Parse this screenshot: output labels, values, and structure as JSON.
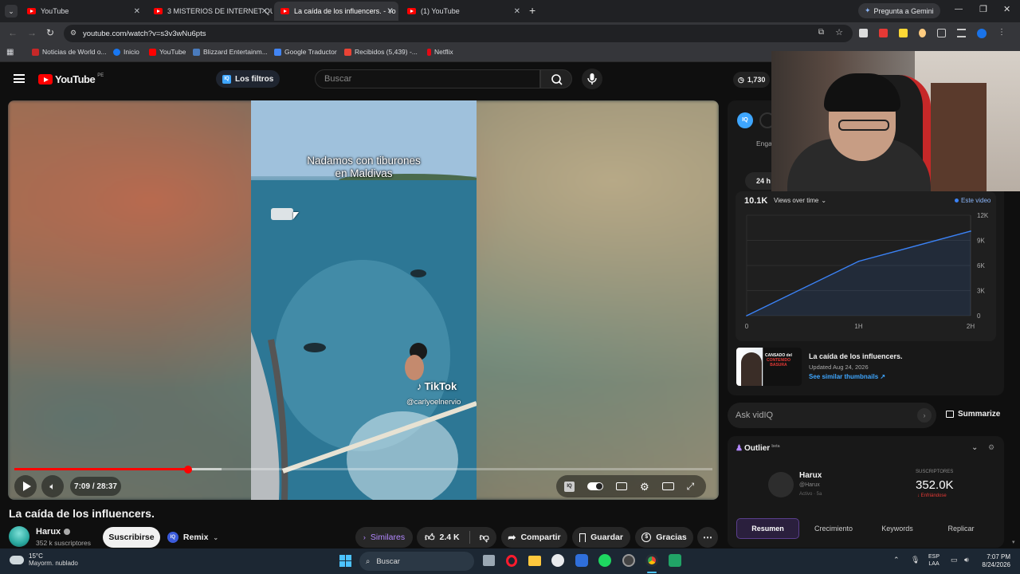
{
  "browser": {
    "tabs": [
      {
        "label": "YouTube",
        "active": false
      },
      {
        "label": "3 MISTERIOS DE INTERNET QUE",
        "active": false
      },
      {
        "label": "La caída de los influencers. - Yo",
        "active": true
      },
      {
        "label": "(1) YouTube",
        "active": false
      }
    ],
    "new_tab": "+",
    "gemini": "Pregunta a Gemini",
    "url": "youtube.com/watch?v=s3v3wNu6pts",
    "bookmarks": [
      "Noticias de World o...",
      "Inicio",
      "YouTube",
      "Blizzard Entertainm...",
      "Google Traductor",
      "Recibidos (5,439) -...",
      "Netflix"
    ]
  },
  "youtube": {
    "logo": "YouTube",
    "region": "PE",
    "filters": "Los filtros",
    "search_placeholder": "Buscar",
    "views_counter": "1,730"
  },
  "video": {
    "overlay_caption_line1": "Nadamos con tiburones",
    "overlay_caption_line2": "en Maldivas",
    "watermark": "TikTok",
    "watermark_user": "@carlyoelnervio",
    "time": "7:09 / 28:37",
    "progress_fraction": 0.249,
    "buffer_fraction": 0.297,
    "title": "La caída de los influencers.",
    "channel": "Harux",
    "subscribers": "352 k suscriptores",
    "subscribe": "Suscribirse",
    "remix": "Remix",
    "similares": "Similares",
    "likes": "2.4 K",
    "share": "Compartir",
    "save": "Guardar",
    "thanks": "Gracias"
  },
  "vidiq": {
    "tab_label": "Enga",
    "range_label": "24 h",
    "views": "10.1K",
    "views_dropdown": "Views over time",
    "legend": "Este video",
    "thumb_title": "La caída de los influencers.",
    "thumb_updated": "Updated Aug 24, 2026",
    "thumb_link": "See similar thumbnails",
    "thumb_text_1": "CANSADO del",
    "thumb_text_2": "CONTENIDO",
    "thumb_text_3": "BASURA",
    "ask_placeholder": "Ask vidIQ",
    "summarize": "Summarize",
    "outlier": "Outlier",
    "outlier_badge": "beta",
    "channel_name": "Harux",
    "channel_handle": "@Harux",
    "channel_status": "Activo · 5a",
    "subs_label": "SUSCRIPTORES",
    "subs_value": "352.0K",
    "subs_trend": "Enfriándose",
    "tabs": [
      "Resumen",
      "Crecimiento",
      "Keywords",
      "Replicar"
    ]
  },
  "chart_data": {
    "type": "line",
    "x": [
      0,
      1,
      2
    ],
    "xtick_labels": [
      "0",
      "1H",
      "2H"
    ],
    "series": [
      {
        "name": "Este video",
        "values": [
          0,
          6500,
          10100
        ]
      }
    ],
    "ylim": [
      0,
      12000
    ],
    "yticks": [
      0,
      3000,
      6000,
      9000,
      12000
    ],
    "ytick_labels": [
      "0",
      "3K",
      "6K",
      "9K",
      "12K"
    ],
    "grid": true,
    "legend_position": "top-right"
  },
  "taskbar": {
    "weather_temp": "15°C",
    "weather_desc": "Mayorm. nublado",
    "search": "Buscar",
    "lang_1": "ESP",
    "lang_2": "LAA",
    "time": "7:07 PM",
    "date": "8/24/2026"
  },
  "colors": {
    "accent": "#ff0000",
    "vidiq_blue": "#3ea6ff",
    "chart_line": "#3b82f6"
  }
}
